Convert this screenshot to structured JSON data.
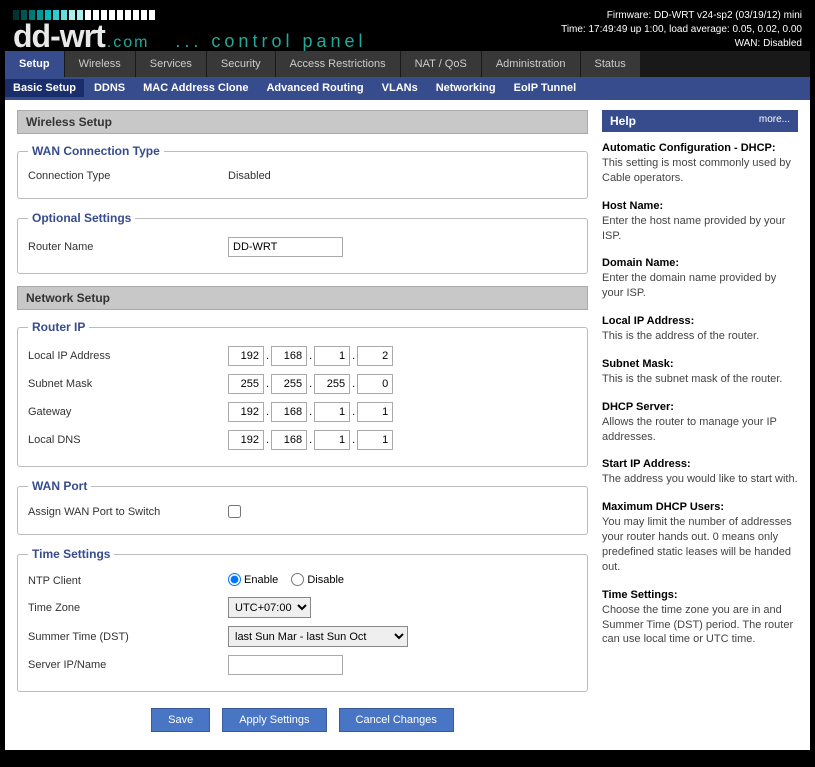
{
  "header": {
    "firmware": "Firmware: DD-WRT v24-sp2 (03/19/12) mini",
    "time": "Time: 17:49:49 up 1:00, load average: 0.05, 0.02, 0.00",
    "wan": "WAN: Disabled",
    "brand_main": "dd-wrt",
    "brand_com": ".com",
    "control_panel": "... control panel"
  },
  "tabs1": [
    "Setup",
    "Wireless",
    "Services",
    "Security",
    "Access Restrictions",
    "NAT / QoS",
    "Administration",
    "Status"
  ],
  "tabs2": [
    "Basic Setup",
    "DDNS",
    "MAC Address Clone",
    "Advanced Routing",
    "VLANs",
    "Networking",
    "EoIP Tunnel"
  ],
  "sections": {
    "wireless_setup": "Wireless Setup",
    "network_setup": "Network Setup"
  },
  "wan": {
    "legend": "WAN Connection Type",
    "conn_type_label": "Connection Type",
    "conn_type_value": "Disabled"
  },
  "optional": {
    "legend": "Optional Settings",
    "router_name_label": "Router Name",
    "router_name_value": "DD-WRT"
  },
  "router_ip": {
    "legend": "Router IP",
    "local_ip_label": "Local IP Address",
    "local_ip": [
      "192",
      "168",
      "1",
      "2"
    ],
    "subnet_label": "Subnet Mask",
    "subnet": [
      "255",
      "255",
      "255",
      "0"
    ],
    "gateway_label": "Gateway",
    "gateway": [
      "192",
      "168",
      "1",
      "1"
    ],
    "dns_label": "Local DNS",
    "dns": [
      "192",
      "168",
      "1",
      "1"
    ]
  },
  "wan_port": {
    "legend": "WAN Port",
    "assign_label": "Assign WAN Port to Switch"
  },
  "time": {
    "legend": "Time Settings",
    "ntp_label": "NTP Client",
    "enable": "Enable",
    "disable": "Disable",
    "tz_label": "Time Zone",
    "tz_value": "UTC+07:00",
    "dst_label": "Summer Time (DST)",
    "dst_value": "last Sun Mar - last Sun Oct",
    "server_label": "Server IP/Name",
    "server_value": ""
  },
  "buttons": {
    "save": "Save",
    "apply": "Apply Settings",
    "cancel": "Cancel Changes"
  },
  "help": {
    "title": "Help",
    "more": "more...",
    "items": [
      {
        "t": "Automatic Configuration - DHCP:",
        "d": "This setting is most commonly used by Cable operators."
      },
      {
        "t": "Host Name:",
        "d": "Enter the host name provided by your ISP."
      },
      {
        "t": "Domain Name:",
        "d": "Enter the domain name provided by your ISP."
      },
      {
        "t": "Local IP Address:",
        "d": "This is the address of the router."
      },
      {
        "t": "Subnet Mask:",
        "d": "This is the subnet mask of the router."
      },
      {
        "t": "DHCP Server:",
        "d": "Allows the router to manage your IP addresses."
      },
      {
        "t": "Start IP Address:",
        "d": "The address you would like to start with."
      },
      {
        "t": "Maximum DHCP Users:",
        "d": "You may limit the number of addresses your router hands out. 0 means only predefined static leases will be handed out."
      },
      {
        "t": "Time Settings:",
        "d": "Choose the time zone you are in and Summer Time (DST) period. The router can use local time or UTC time."
      }
    ]
  }
}
